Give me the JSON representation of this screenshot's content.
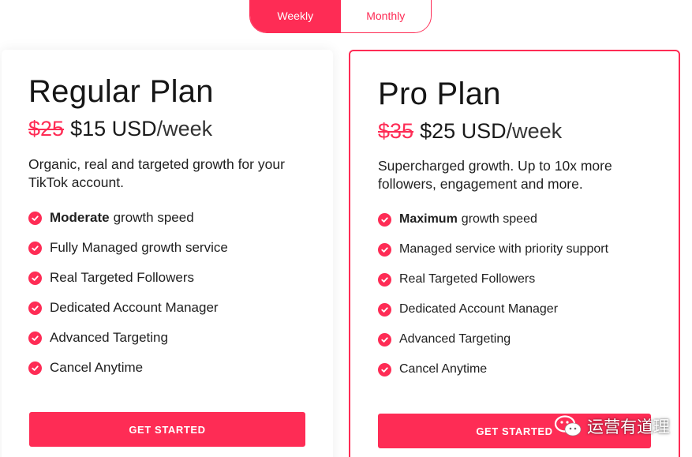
{
  "colors": {
    "accent": "#fe2c55",
    "text": "#1a1a1a"
  },
  "toggle": {
    "weekly": "Weekly",
    "monthly": "Monthly",
    "selected": "Weekly"
  },
  "plans": [
    {
      "title": "Regular Plan",
      "old_price": "$25",
      "new_price": "$15 USD",
      "period": "/week",
      "description": "Organic, real and targeted growth for your TikTok account.",
      "features": [
        {
          "bold": "Moderate",
          "text": "growth speed"
        },
        {
          "bold": "",
          "text": "Fully Managed growth service"
        },
        {
          "bold": "",
          "text": "Real Targeted Followers"
        },
        {
          "bold": "",
          "text": "Dedicated Account Manager"
        },
        {
          "bold": "",
          "text": "Advanced Targeting"
        },
        {
          "bold": "",
          "text": "Cancel Anytime"
        }
      ],
      "cta": "GET STARTED"
    },
    {
      "title": "Pro Plan",
      "old_price": "$35",
      "new_price": "$25 USD",
      "period": "/week",
      "description": "Supercharged growth. Up to 10x more followers, engagement and more.",
      "features": [
        {
          "bold": "Maximum",
          "text": "growth speed"
        },
        {
          "bold": "",
          "text": "Managed service with priority support"
        },
        {
          "bold": "",
          "text": "Real Targeted Followers"
        },
        {
          "bold": "",
          "text": "Dedicated Account Manager"
        },
        {
          "bold": "",
          "text": "Advanced Targeting"
        },
        {
          "bold": "",
          "text": "Cancel Anytime"
        }
      ],
      "cta": "GET STARTED"
    }
  ],
  "watermark": {
    "icon": "wechat-icon",
    "text": "运营有道理"
  }
}
